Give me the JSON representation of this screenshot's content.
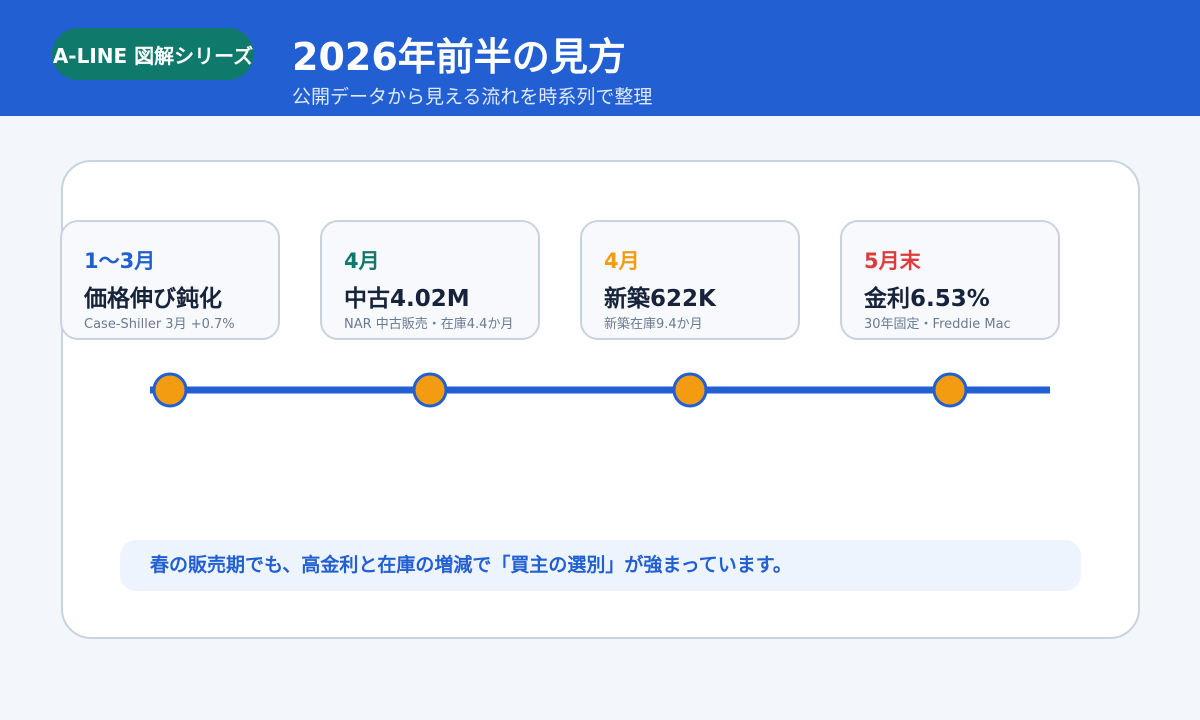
{
  "header": {
    "series_badge": "A-LINE 図解シリーズ",
    "title": "2026年前半の見方",
    "subtitle": "公開データから見える流れを時系列で整理"
  },
  "timeline": {
    "events": [
      {
        "period": "1〜3月",
        "headline": "価格伸び鈍化",
        "note": "Case-Shiller 3月 +0.7%",
        "accent": "#1f5fcf"
      },
      {
        "period": "4月",
        "headline": "中古4.02M",
        "note": "NAR 中古販売・在庫4.4か月",
        "accent": "#0f7a6b"
      },
      {
        "period": "4月",
        "headline": "新築622K",
        "note": "新築在庫9.4か月",
        "accent": "#f39c12"
      },
      {
        "period": "5月末",
        "headline": "金利6.53%",
        "note": "30年固定・Freddie Mac",
        "accent": "#e03b3b"
      }
    ]
  },
  "summary": {
    "text": "春の販売期でも、高金利と在庫の増減で「買主の選別」が強まっています。"
  },
  "colors": {
    "header_bg": "#215fd2",
    "badge_bg": "#0f7a6b",
    "timeline_line": "#215fd2",
    "marker_fill": "#f39c12",
    "marker_stroke": "#215fd2"
  }
}
